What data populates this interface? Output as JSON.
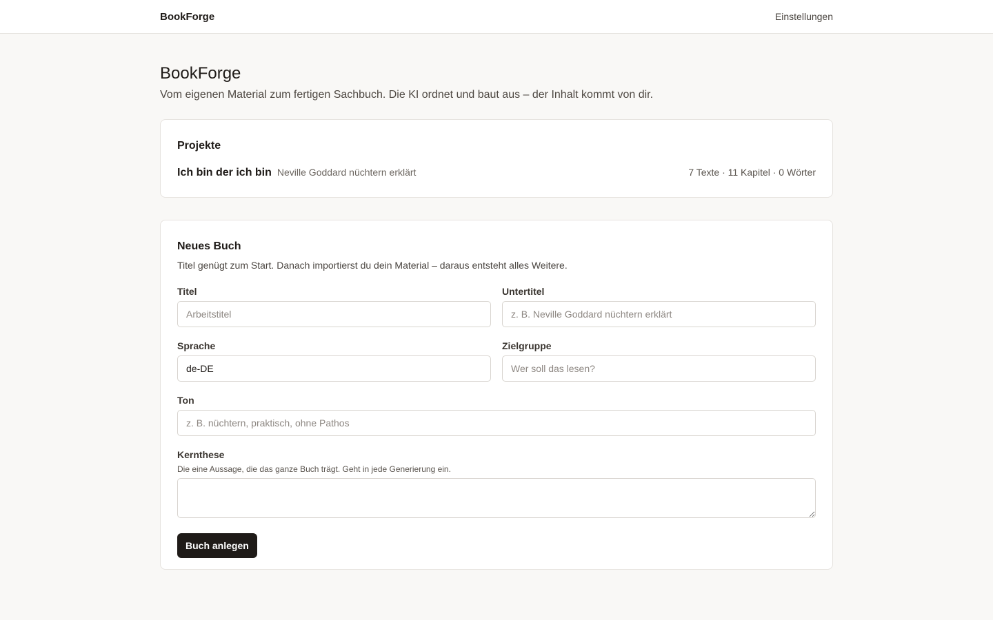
{
  "header": {
    "brand": "BookForge",
    "settings_label": "Einstellungen"
  },
  "hero": {
    "title": "BookForge",
    "subtitle": "Vom eigenen Material zum fertigen Sachbuch. Die KI ordnet und baut aus – der Inhalt kommt von dir."
  },
  "projects": {
    "title": "Projekte",
    "items": [
      {
        "title": "Ich bin der ich bin",
        "subtitle": "Neville Goddard nüchtern erklärt",
        "stats": "7 Texte · 11 Kapitel · 0 Wörter"
      }
    ]
  },
  "new_book": {
    "title": "Neues Buch",
    "description": "Titel genügt zum Start. Danach importierst du dein Material – daraus entsteht alles Weitere.",
    "fields": {
      "title": {
        "label": "Titel",
        "placeholder": "Arbeitstitel",
        "value": ""
      },
      "subtitle": {
        "label": "Untertitel",
        "placeholder": "z. B. Neville Goddard nüchtern erklärt",
        "value": ""
      },
      "language": {
        "label": "Sprache",
        "placeholder": "",
        "value": "de-DE"
      },
      "audience": {
        "label": "Zielgruppe",
        "placeholder": "Wer soll das lesen?",
        "value": ""
      },
      "tone": {
        "label": "Ton",
        "placeholder": "z. B. nüchtern, praktisch, ohne Pathos",
        "value": ""
      },
      "thesis": {
        "label": "Kernthese",
        "hint": "Die eine Aussage, die das ganze Buch trägt. Geht in jede Generierung ein.",
        "value": ""
      }
    },
    "submit_label": "Buch anlegen"
  }
}
